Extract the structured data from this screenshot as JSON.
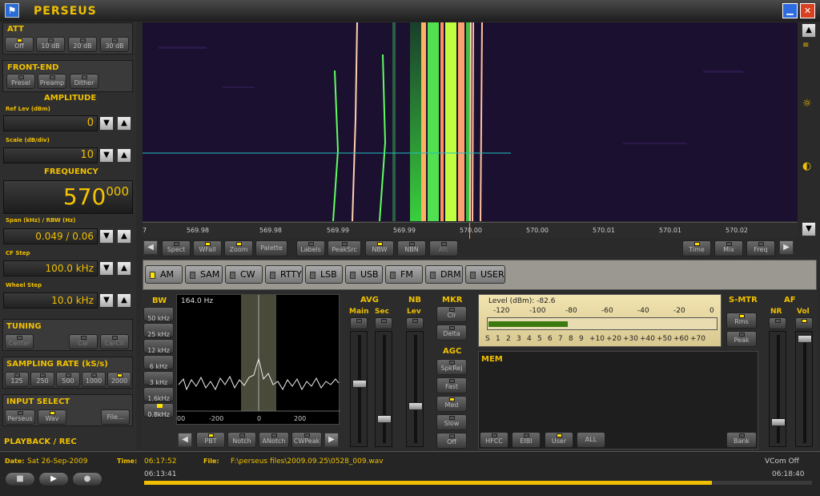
{
  "app": {
    "title": "PERSEUS"
  },
  "att": {
    "title": "ATT",
    "buttons": [
      "Off",
      "10 dB",
      "20 dB",
      "30 dB"
    ],
    "active": 0
  },
  "frontend": {
    "title": "FRONT-END",
    "buttons": [
      "Presel",
      "Preamp",
      "Dither"
    ]
  },
  "amplitude": {
    "title": "AMPLITUDE",
    "ref_label": "Ref Lev (dBm)",
    "ref_value": "0",
    "scale_label": "Scale (dB/div)",
    "scale_value": "10"
  },
  "frequency": {
    "title": "FREQUENCY",
    "main": "570",
    "frac": "000",
    "span_label": "Span (kHz) / RBW (Hz)",
    "span_value": "0.049 / 0.06",
    "cf_label": "CF Step",
    "cf_value": "100.0 kHz",
    "wheel_label": "Wheel Step",
    "wheel_value": "10.0 kHz"
  },
  "tuning": {
    "title": "TUNING",
    "buttons": [
      "Center",
      "Car",
      "CarClr"
    ]
  },
  "sampling": {
    "title": "SAMPLING RATE (kS/s)",
    "buttons": [
      "125",
      "250",
      "500",
      "1000",
      "2000"
    ],
    "active": 4
  },
  "input": {
    "title": "INPUT SELECT",
    "buttons": [
      "Perseus",
      "Wav",
      "File..."
    ]
  },
  "playback": {
    "title": "PLAYBACK / REC"
  },
  "freq_axis": {
    "ticks": [
      "7",
      "569.98",
      "569.98",
      "569.99",
      "569.99",
      "570.00",
      "570.00",
      "570.01",
      "570.01",
      "570.02"
    ]
  },
  "toolbar1": {
    "left": [
      "Spect",
      "WFall",
      "Zoom",
      "Palette",
      "Labels",
      "PeakSrc",
      "NBW",
      "NBN",
      "Afc"
    ],
    "right": [
      "Time",
      "Mix",
      "Freq"
    ]
  },
  "modes": [
    "AM",
    "SAM",
    "CW",
    "RTTY",
    "LSB",
    "USB",
    "FM",
    "DRM",
    "USER"
  ],
  "bw": {
    "title": "BW",
    "buttons": [
      "50 kHz",
      "25 kHz",
      "12 kHz",
      "6 kHz",
      "3 kHz",
      "1.6kHz",
      "0.8kHz"
    ],
    "active": 6,
    "readout": "164.0 Hz",
    "ticks": [
      "00",
      "-200",
      "0",
      "200"
    ]
  },
  "filters": [
    "PBT",
    "Notch",
    "ANotch",
    "CWPeak"
  ],
  "avg": {
    "title": "AVG",
    "main": "Main",
    "sec": "Sec"
  },
  "nb": {
    "title": "NB",
    "lev": "Lev"
  },
  "mkr": {
    "title": "MKR",
    "clr": "Clr",
    "delta": "Delta"
  },
  "agc": {
    "title": "AGC",
    "buttons": [
      "SpkRej",
      "Fast",
      "Med",
      "Slow",
      "Off"
    ],
    "active": 2
  },
  "smeter": {
    "level_label": "Level (dBm): -82.6",
    "dbm_scale": [
      "-120",
      "-100",
      "-80",
      "-60",
      "-40",
      "-20",
      "0"
    ],
    "s_scale": [
      "S",
      "1",
      "2",
      "3",
      "4",
      "5",
      "6",
      "7",
      "8",
      "9",
      "+10",
      "+20",
      "+30",
      "+40",
      "+50",
      "+60",
      "+70"
    ],
    "level_fraction": 0.35
  },
  "smtr": {
    "title": "S-MTR",
    "rms": "Rms",
    "peak": "Peak"
  },
  "af": {
    "title": "AF",
    "nr": "NR",
    "vol": "Vol"
  },
  "mem": {
    "title": "MEM",
    "buttons": [
      "HFCC",
      "EIBI",
      "User",
      "ALL"
    ],
    "bank": "Bank"
  },
  "status": {
    "date_label": "Date:",
    "date_value": "Sat 26-Sep-2009",
    "time_label": "Time:",
    "time_value": "06:17:52",
    "file_label": "File:",
    "file_value": "F:\\perseus files\\2009.09.25\\0528_009.wav",
    "vcom": "VCom Off",
    "start": "06:13:41",
    "end": "06:18:40",
    "progress": 0.85
  }
}
